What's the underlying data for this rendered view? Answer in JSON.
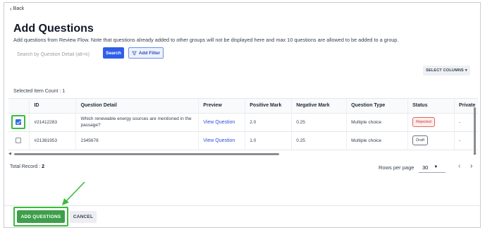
{
  "nav": {
    "back_label": "Back"
  },
  "header": {
    "title": "Add Questions",
    "subtitle": "Add questions from Review Flow. Note that questions already added to other groups will not be displayed here and max 10 questions are allowed to be added to a group."
  },
  "toolbar": {
    "search_placeholder": "Search by Question Detail (alt+k)",
    "search_label": "Search",
    "filter_label": "Add Filter",
    "select_columns_label": "SELECT COLUMNS"
  },
  "selection": {
    "label": "Selected Item Count : 1"
  },
  "table": {
    "columns": [
      "ID",
      "Question Detail",
      "Preview",
      "Positive Mark",
      "Negative Mark",
      "Question Type",
      "Status",
      "Private"
    ],
    "rows": [
      {
        "checked": true,
        "id": "#21412283",
        "question": "Which renewable energy sources are mentioned in the passage?",
        "preview": "View Question",
        "positive": "2.0",
        "negative": "0.25",
        "type": "Multiple choice",
        "status": "Rejected",
        "private": "-"
      },
      {
        "checked": false,
        "id": "#21381953",
        "question": "2345678",
        "preview": "View Question",
        "positive": "1.0",
        "negative": "0.25",
        "type": "Multiple choice",
        "status": "Draft",
        "private": "-"
      }
    ]
  },
  "footer": {
    "total_label": "Total Record :",
    "total_value": "2",
    "rows_per_page_label": "Rows per page",
    "rows_per_page_value": "30",
    "add_button": "ADD QUESTIONS",
    "cancel_button": "CANCEL"
  },
  "colors": {
    "primary": "#2f5ee9",
    "success": "#3e9f4a",
    "highlight": "#3cbb3c",
    "rejected": "#c0392b"
  },
  "icons": [
    "chevron-left-icon",
    "filter-icon",
    "chevron-down-icon",
    "checkbox-icon",
    "arrow-icon"
  ]
}
